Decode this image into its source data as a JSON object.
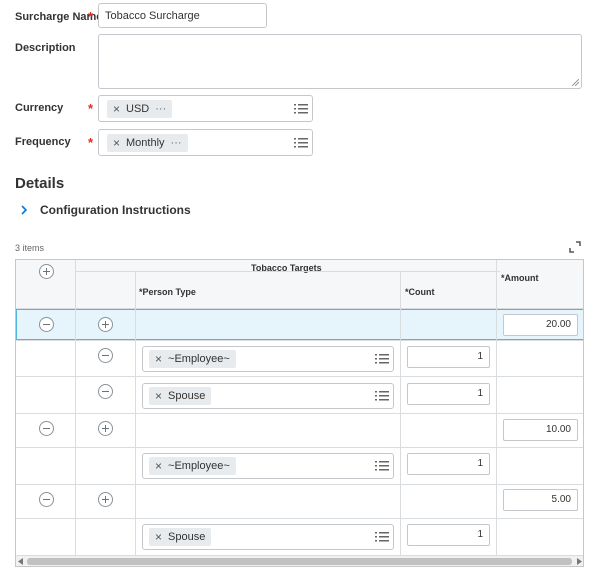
{
  "form": {
    "surcharge_name": {
      "label": "Surcharge Name",
      "required": "*",
      "value": "Tobacco Surcharge"
    },
    "description": {
      "label": "Description",
      "value": ""
    },
    "currency": {
      "label": "Currency",
      "required": "*",
      "pill": "USD",
      "pill_remove": "×",
      "pill_more": "···"
    },
    "frequency": {
      "label": "Frequency",
      "required": "*",
      "pill": "Monthly",
      "pill_remove": "×",
      "pill_more": "···"
    }
  },
  "details": {
    "title": "Details",
    "configuration": {
      "chevron": "›",
      "label": "Configuration Instructions"
    }
  },
  "grid": {
    "item_count": "3 items",
    "group_header": "Tobacco Targets",
    "col_person_type": "*Person Type",
    "col_count": "*Count",
    "col_amount": "*Amount",
    "rows": [
      {
        "amount": "20.00",
        "targets": [
          {
            "person_type": "~Employee~",
            "count": "1"
          },
          {
            "person_type": "Spouse",
            "count": "1"
          }
        ]
      },
      {
        "amount": "10.00",
        "targets": [
          {
            "person_type": "~Employee~",
            "count": "1"
          }
        ]
      },
      {
        "amount": "5.00",
        "targets": [
          {
            "person_type": "Spouse",
            "count": "1"
          }
        ]
      }
    ],
    "remove_glyph": "×"
  },
  "colors": {
    "accent": "#0875e1",
    "required": "#de2e21",
    "selected_row": "#e6f4fb",
    "selected_border": "#52b4e3"
  }
}
